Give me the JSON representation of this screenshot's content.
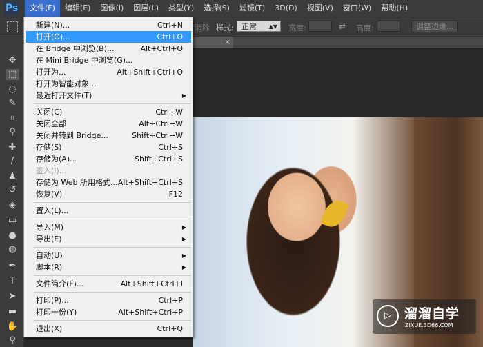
{
  "app": {
    "logo": "Ps"
  },
  "menubar": {
    "items": [
      "文件(F)",
      "编辑(E)",
      "图像(I)",
      "图层(L)",
      "类型(Y)",
      "选择(S)",
      "滤镜(T)",
      "3D(D)",
      "视图(V)",
      "窗口(W)",
      "帮助(H)"
    ],
    "active_index": 0
  },
  "options": {
    "style_label": "样式:",
    "style_value": "正常",
    "width_label": "宽度:",
    "height_label": "高度:",
    "refine_edge": "调整边缘...",
    "partial_label": "消除"
  },
  "document": {
    "tab_marker": "×"
  },
  "file_menu": {
    "items": [
      {
        "label": "新建(N)...",
        "shortcut": "Ctrl+N"
      },
      {
        "label": "打开(O)...",
        "shortcut": "Ctrl+O",
        "highlighted": true
      },
      {
        "label": "在 Bridge 中浏览(B)...",
        "shortcut": "Alt+Ctrl+O"
      },
      {
        "label": "在 Mini Bridge 中浏览(G)...",
        "shortcut": ""
      },
      {
        "label": "打开为...",
        "shortcut": "Alt+Shift+Ctrl+O"
      },
      {
        "label": "打开为智能对象...",
        "shortcut": ""
      },
      {
        "label": "最近打开文件(T)",
        "shortcut": "",
        "submenu": true
      },
      {
        "label": "关闭(C)",
        "shortcut": "Ctrl+W"
      },
      {
        "label": "关闭全部",
        "shortcut": "Alt+Ctrl+W"
      },
      {
        "label": "关闭并转到 Bridge...",
        "shortcut": "Shift+Ctrl+W"
      },
      {
        "label": "存储(S)",
        "shortcut": "Ctrl+S"
      },
      {
        "label": "存储为(A)...",
        "shortcut": "Shift+Ctrl+S"
      },
      {
        "label": "签入(I)...",
        "shortcut": "",
        "disabled": true
      },
      {
        "label": "存储为 Web 所用格式...",
        "shortcut": "Alt+Shift+Ctrl+S"
      },
      {
        "label": "恢复(V)",
        "shortcut": "F12"
      },
      {
        "label": "置入(L)...",
        "shortcut": ""
      },
      {
        "label": "导入(M)",
        "shortcut": "",
        "submenu": true
      },
      {
        "label": "导出(E)",
        "shortcut": "",
        "submenu": true
      },
      {
        "label": "自动(U)",
        "shortcut": "",
        "submenu": true
      },
      {
        "label": "脚本(R)",
        "shortcut": "",
        "submenu": true
      },
      {
        "label": "文件简介(F)...",
        "shortcut": "Alt+Shift+Ctrl+I"
      },
      {
        "label": "打印(P)...",
        "shortcut": "Ctrl+P"
      },
      {
        "label": "打印一份(Y)",
        "shortcut": "Alt+Shift+Ctrl+P"
      },
      {
        "label": "退出(X)",
        "shortcut": "Ctrl+Q"
      }
    ]
  },
  "watermark": {
    "title": "溜溜自学",
    "url": "ZIXUE.3D66.COM"
  },
  "tools": [
    "move-icon",
    "marquee-icon",
    "lasso-icon",
    "quick-select-icon",
    "crop-icon",
    "eyedropper-icon",
    "healing-brush-icon",
    "brush-icon",
    "clone-stamp-icon",
    "history-brush-icon",
    "eraser-icon",
    "gradient-icon",
    "blur-icon",
    "dodge-icon",
    "pen-icon",
    "type-icon",
    "path-select-icon",
    "rectangle-icon",
    "hand-icon",
    "zoom-icon"
  ]
}
